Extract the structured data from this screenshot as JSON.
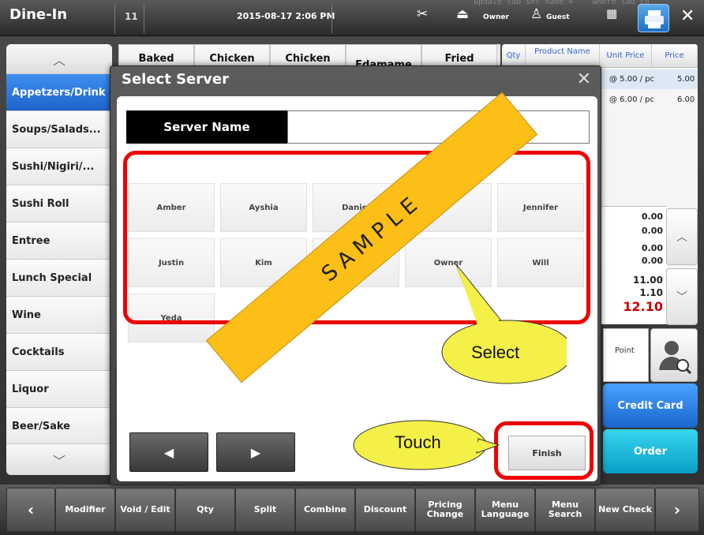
{
  "header": {
    "title": "Dine-In",
    "table_number": "11",
    "datetime": "2015-08-17   2:06 PM",
    "code_snippet": "update tab set name = '' where tab co",
    "user_label": "Owner",
    "guest_label": "Guest"
  },
  "categories": {
    "items": [
      "Appetzers/Drink",
      "Soups/Salads...",
      "Sushi/Nigiri/...",
      "Sushi Roll",
      "Entree",
      "Lunch Special",
      "Wine",
      "Cocktails",
      "Liquor",
      "Beer/Sake"
    ],
    "active_index": 0
  },
  "menu_items": [
    "Baked",
    "Chicken",
    "Chicken",
    "Edamame",
    "Fried"
  ],
  "order": {
    "columns": [
      "Qty",
      "Product Name",
      "Unit Price",
      "Price"
    ],
    "rows": [
      {
        "unit": "@ 5.00 / pc",
        "price": "5.00"
      },
      {
        "unit": "@ 6.00 / pc",
        "price": "6.00"
      }
    ],
    "totals": [
      "0.00",
      "0.00",
      "0.00",
      "0.00",
      "11.00",
      "1.10"
    ],
    "grand_total": "12.10",
    "point_label": "Point"
  },
  "actions": {
    "credit_card": "Credit Card",
    "order": "Order"
  },
  "toolbar": [
    "Modifier",
    "Void / Edit",
    "Qty",
    "Split",
    "Combine",
    "Discount",
    "Pricing Change",
    "Menu Language",
    "Menu Search",
    "New Check"
  ],
  "dialog": {
    "title": "Select Server",
    "server_name_label": "Server Name",
    "server_name_value": "",
    "servers": [
      "Amber",
      "Ayshia",
      "Daniel",
      "",
      "Jennifer",
      "Justin",
      "Kim",
      "",
      "Owner",
      "Will",
      "Yeda"
    ],
    "finish_label": "Finish"
  },
  "annotations": {
    "watermark": "SAMPLE",
    "select_callout": "Select",
    "touch_callout": "Touch"
  },
  "colors": {
    "accent_blue": "#2a76d8",
    "highlight_red": "#e00000",
    "banner_yellow": "#fbbf17",
    "callout_yellow": "#f5f048",
    "total_red": "#cc0000"
  }
}
